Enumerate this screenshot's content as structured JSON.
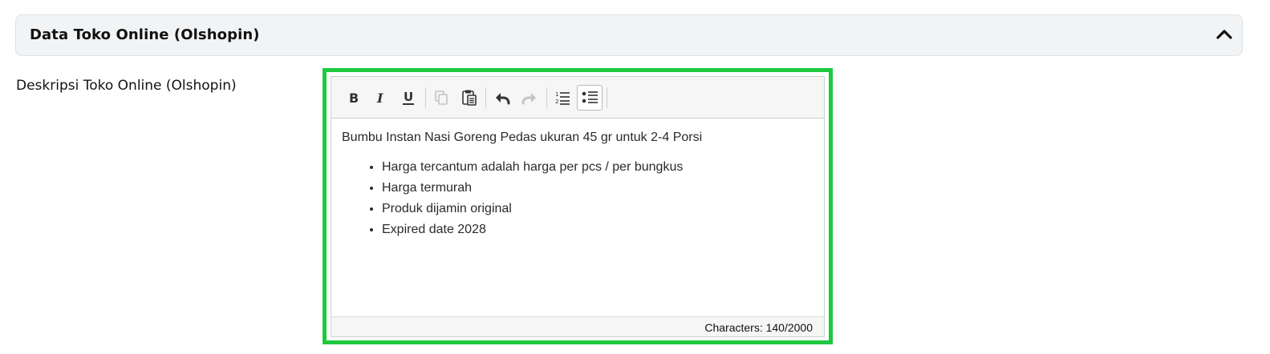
{
  "section": {
    "title": "Data Toko Online (Olshopin)",
    "collapse_icon": "chevron-up-icon"
  },
  "field": {
    "label": "Deskripsi Toko Online (Olshopin)"
  },
  "editor": {
    "toolbar": [
      {
        "name": "bold",
        "icon": "bold-icon",
        "enabled": true
      },
      {
        "name": "italic",
        "icon": "italic-icon",
        "enabled": true
      },
      {
        "name": "underline",
        "icon": "underline-icon",
        "enabled": true
      },
      {
        "name": "copy",
        "icon": "copy-icon",
        "enabled": false
      },
      {
        "name": "paste",
        "icon": "paste-icon",
        "enabled": true
      },
      {
        "name": "undo",
        "icon": "undo-icon",
        "enabled": true
      },
      {
        "name": "redo",
        "icon": "redo-icon",
        "enabled": false
      },
      {
        "name": "ordered-list",
        "icon": "ordered-list-icon",
        "enabled": true
      },
      {
        "name": "unordered-list",
        "icon": "unordered-list-icon",
        "enabled": true,
        "active": true
      }
    ],
    "content": {
      "paragraph": "Bumbu Instan Nasi Goreng Pedas ukuran 45 gr untuk 2-4 Porsi",
      "bullets": [
        "Harga tercantum adalah harga per pcs / per bungkus",
        "Harga termurah",
        "Produk dijamin original",
        "Expired date 2028"
      ]
    },
    "char_count": "Characters: 140/2000"
  },
  "colors": {
    "highlight": "#1ec940",
    "header_bg": "#f1f3f5",
    "toolbar_bg": "#f6f6f6"
  }
}
